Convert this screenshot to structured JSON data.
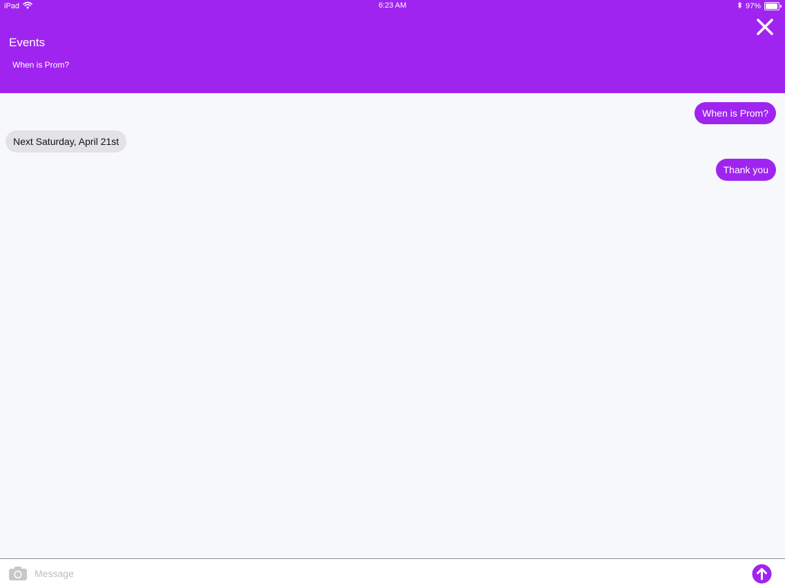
{
  "status_bar": {
    "device": "iPad",
    "time": "6:23 AM",
    "battery": "97%",
    "battery_level": 0.97
  },
  "header": {
    "title": "Events",
    "subtitle": "When is Prom?",
    "close_icon": "close-icon"
  },
  "messages": [
    {
      "direction": "out",
      "text": "When is Prom?"
    },
    {
      "direction": "in",
      "text": "Next Saturday, April 21st"
    },
    {
      "direction": "out",
      "text": "Thank you"
    }
  ],
  "composer": {
    "placeholder": "Message",
    "value": "",
    "camera_icon": "camera-icon",
    "send_icon": "send-arrow-up-icon"
  },
  "colors": {
    "accent": "#a024ef",
    "incoming_bubble": "#e3e3e6",
    "background": "#f7f8fb"
  }
}
